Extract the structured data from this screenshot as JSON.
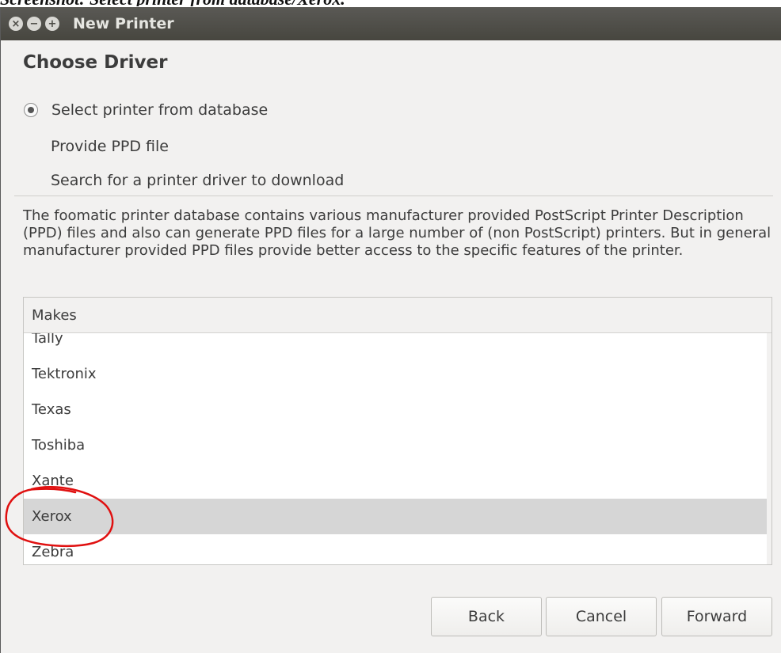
{
  "caption": "Screenshot: Select printer from database/Xerox.",
  "window": {
    "title": "New Printer",
    "controls": [
      "close-icon",
      "minimize-icon",
      "maximize-icon"
    ]
  },
  "page": {
    "heading": "Choose Driver",
    "options": [
      {
        "label": "Select printer from database",
        "selected": true
      },
      {
        "label": "Provide PPD file",
        "selected": false
      },
      {
        "label": "Search for a printer driver to download",
        "selected": false
      }
    ],
    "description": "The foomatic printer database contains various manufacturer provided PostScript Printer Description (PPD) files and also can generate PPD files for a large number of (non PostScript) printers. But in general manufacturer provided PPD files provide better access to the specific features of the printer."
  },
  "makes": {
    "header": "Makes",
    "items": [
      "Tally",
      "Tektronix",
      "Texas",
      "Toshiba",
      "Xante",
      "Xerox",
      "Zebra"
    ],
    "selected": "Xerox"
  },
  "buttons": {
    "back": "Back",
    "cancel": "Cancel",
    "forward": "Forward"
  },
  "colors": {
    "titlebar": "#4d4c47",
    "selection": "#d6d6d6",
    "annotation": "#e01010"
  }
}
